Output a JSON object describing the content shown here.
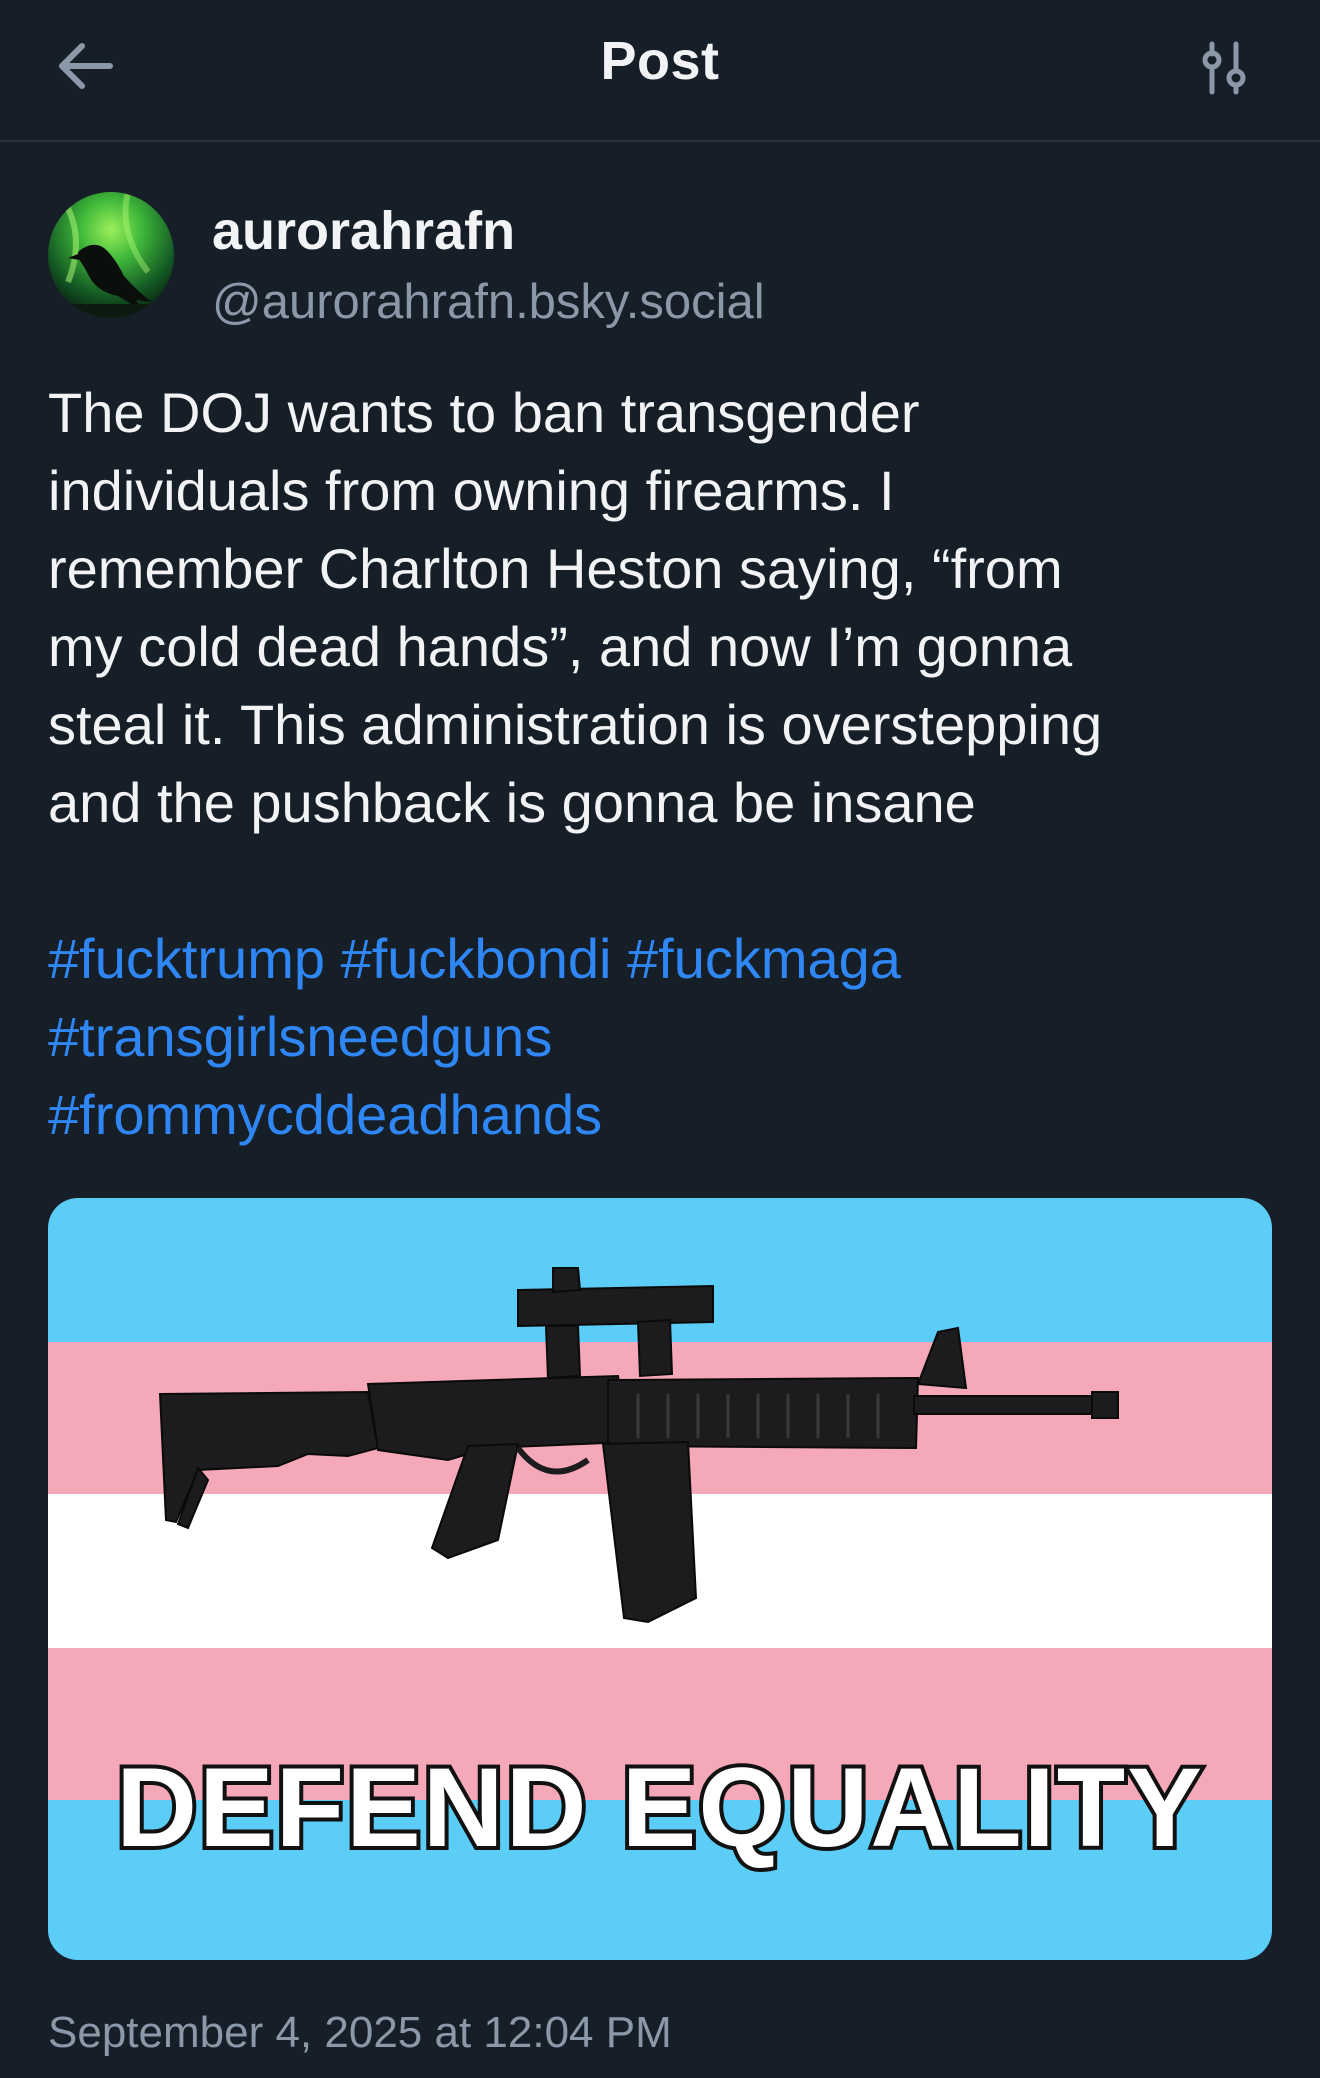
{
  "header": {
    "back_icon": "arrow-left-icon",
    "title": "Post",
    "settings_icon": "sliders-icon"
  },
  "author": {
    "display_name": "aurorahrafn",
    "handle": "@aurorahrafn.bsky.social",
    "avatar_icon": "raven-aurora-avatar"
  },
  "post": {
    "text_lines": [
      "The DOJ wants to ban transgender",
      "individuals from owning firearms. I",
      "remember Charlton Heston saying, “from",
      "my cold dead hands”, and now I’m gonna",
      "steal it. This administration is overstepping",
      "and the pushback is gonna be insane"
    ],
    "hashtags": [
      "#fucktrump",
      "#fuckbondi",
      "#fuckmaga",
      "#transgirlsneedguns",
      "#frommycddeadhands"
    ],
    "image": {
      "caption": "DEFEND EQUALITY",
      "flag_colors": {
        "blue": "#5bcdf7",
        "pink": "#f4a8b8",
        "white": "#ffffff"
      }
    },
    "timestamp": "September 4, 2025 at 12:04 PM"
  },
  "colors": {
    "background": "#161e27",
    "accent": "#2f86f5",
    "muted": "#8b98a7"
  }
}
